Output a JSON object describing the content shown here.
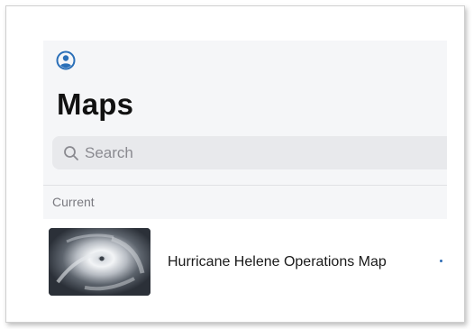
{
  "header": {
    "title": "Maps",
    "profile_icon": "user-circle-icon"
  },
  "search": {
    "placeholder": "Search",
    "icon": "search-icon"
  },
  "section": {
    "label": "Current"
  },
  "maps": [
    {
      "title": "Hurricane Helene Operations Map",
      "thumbnail": "hurricane-satellite-thumbnail"
    }
  ],
  "colors": {
    "accent": "#2a6fb8",
    "panel_background": "#f5f6f8",
    "search_background": "#e8e9ec"
  }
}
